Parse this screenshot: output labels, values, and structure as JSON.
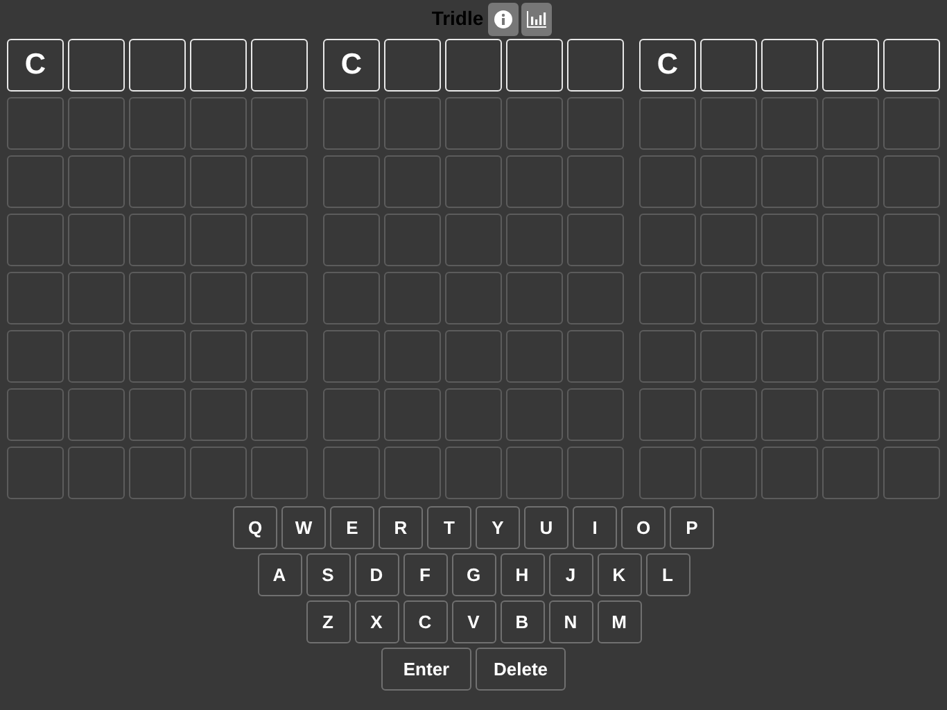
{
  "header": {
    "title": "Tridle"
  },
  "boards": [
    {
      "rows": [
        {
          "active": true,
          "letters": [
            "C"
          ]
        },
        {
          "active": false
        },
        {
          "active": false
        },
        {
          "active": false
        },
        {
          "active": false
        },
        {
          "active": false
        },
        {
          "active": false
        },
        {
          "active": false
        }
      ]
    },
    {
      "rows": [
        {
          "active": true,
          "letters": [
            "C"
          ]
        },
        {
          "active": false
        },
        {
          "active": false
        },
        {
          "active": false
        },
        {
          "active": false
        },
        {
          "active": false
        },
        {
          "active": false
        },
        {
          "active": false
        }
      ]
    },
    {
      "rows": [
        {
          "active": true,
          "letters": [
            "C"
          ]
        },
        {
          "active": false
        },
        {
          "active": false
        },
        {
          "active": false
        },
        {
          "active": false
        },
        {
          "active": false
        },
        {
          "active": false
        },
        {
          "active": false
        }
      ]
    }
  ],
  "keyboard": [
    [
      "Q",
      "W",
      "E",
      "R",
      "T",
      "Y",
      "U",
      "I",
      "O",
      "P"
    ],
    [
      "A",
      "S",
      "D",
      "F",
      "G",
      "H",
      "J",
      "K",
      "L"
    ],
    [
      "Z",
      "X",
      "C",
      "V",
      "B",
      "N",
      "M"
    ],
    [
      "Enter",
      "Delete"
    ]
  ]
}
